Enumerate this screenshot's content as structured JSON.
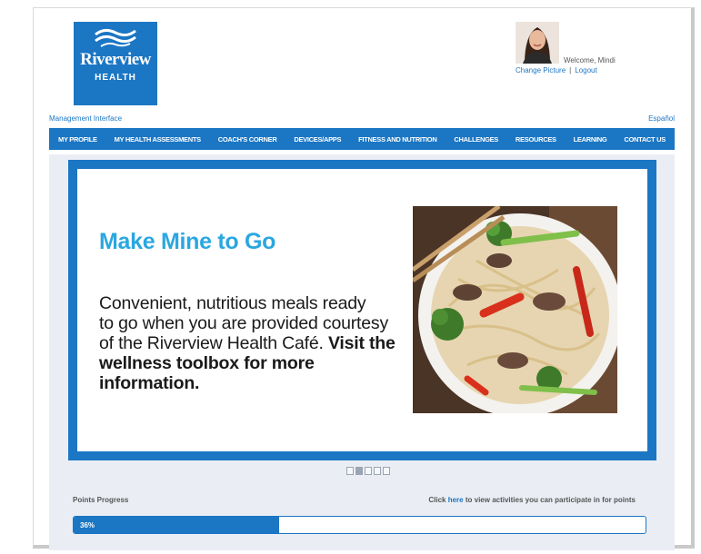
{
  "brand": {
    "name": "Riverview",
    "sub": "HEALTH",
    "color": "#1b76c4"
  },
  "user": {
    "welcome": "Welcome, Mindi",
    "change_picture": "Change Picture",
    "separator": "|",
    "logout": "Logout"
  },
  "links": {
    "management": "Management Interface",
    "language": "Español"
  },
  "nav": {
    "items": [
      {
        "label": "MY PROFILE"
      },
      {
        "label": "MY HEALTH ASSESSMENTS"
      },
      {
        "label": "COACH'S CORNER"
      },
      {
        "label": "DEVICES/APPS"
      },
      {
        "label": "FITNESS AND NUTRITION"
      },
      {
        "label": "CHALLENGES"
      },
      {
        "label": "RESOURCES"
      },
      {
        "label": "LEARNING"
      },
      {
        "label": "CONTACT US"
      }
    ]
  },
  "slide": {
    "title": "Make Mine to Go",
    "body_lines": [
      "Convenient, nutritious meals ready",
      "to go when you are provided courtesy",
      "of the Riverview Health Café. "
    ],
    "body_bold_1": "Visit the",
    "body_bold_2": "wellness toolbox for more information.",
    "image": "noodle-stir-fry-bowl",
    "title_color": "#2aa7e0"
  },
  "carousel": {
    "count": 5,
    "active_index": 1
  },
  "points": {
    "label": "Points Progress",
    "click_prefix": "Click ",
    "click_link": "here",
    "click_suffix": " to view activities you can participate in for points",
    "percent_text": "36%",
    "percent_value": 0.36
  }
}
